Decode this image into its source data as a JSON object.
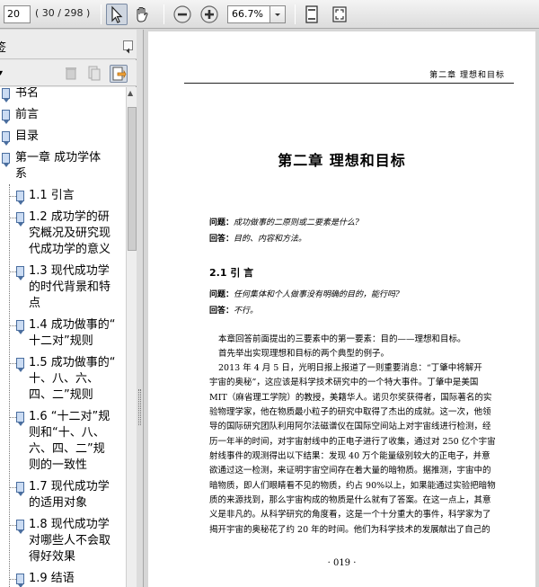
{
  "toolbar": {
    "page_current": "20",
    "page_count": "( 30 / 298 )",
    "zoom_value": "66.7%",
    "icons": [
      "select-tool-icon",
      "hand-tool-icon",
      "zoom-out-icon",
      "zoom-in-icon",
      "fit-page-icon",
      "full-screen-icon"
    ]
  },
  "sidebar": {
    "title": "签",
    "bookmarks": [
      {
        "lines": [
          "书名"
        ]
      },
      {
        "lines": [
          "前言"
        ]
      },
      {
        "lines": [
          "目录"
        ]
      },
      {
        "lines": [
          "第一章  成功学体",
          "系"
        ]
      },
      {
        "lines": [
          "1.1  引言"
        ]
      },
      {
        "lines": [
          "1.2  成功学的研",
          "究概况及研究现",
          "代成功学的意义"
        ]
      },
      {
        "lines": [
          "1.3  现代成功学",
          "的时代背景和特",
          "点"
        ]
      },
      {
        "lines": [
          "1.4  成功做事的“",
          "十二对”规则"
        ]
      },
      {
        "lines": [
          "1.5  成功做事的“",
          "十、八、六、",
          "四、二”规则"
        ]
      },
      {
        "lines": [
          "1.6  “十二对”规",
          "则和“十、八、",
          "六、四、二”规",
          "则的一致性"
        ]
      },
      {
        "lines": [
          "1.7  现代成功学",
          "的适用对象"
        ]
      },
      {
        "lines": [
          "1.8  现代成功学",
          "对哪些人不会取",
          "得好效果"
        ]
      },
      {
        "lines": [
          "1.9  结语"
        ]
      }
    ]
  },
  "document": {
    "running_head": "第二章  理想和目标",
    "chapter_title": "第二章    理想和目标",
    "qa1": [
      {
        "label": "问题：",
        "text": "成功做事的二原则或二要素是什么?"
      },
      {
        "label": "回答：",
        "text": "目的、内容和方法。"
      }
    ],
    "section_title": "2.1  引    言",
    "qa2": [
      {
        "label": "问题：",
        "text": "任何集体和个人做事没有明确的目的，能行吗?"
      },
      {
        "label": "回答：",
        "text": "不行。"
      }
    ],
    "paragraphs": [
      "本章回答前面提出的三要素中的第一要素：目的——理想和目标。",
      "首先举出实现理想和目标的两个典型的例子。",
      "2013 年 4 月 5 日，光明日报上报道了一则重要消息：“丁肇中将解开",
      "宇宙的奥秘”，这应该是科学技术研究中的一个特大事件。丁肇中是美国",
      "MIT（麻省理工学院）的教授，美籍华人。诺贝尔奖获得者，国际著名的实",
      "验物理学家，他在物质最小粒子的研究中取得了杰出的成就。这一次，他领",
      "导的国际研究团队利用阿尔法磁谱仪在国际空间站上对宇宙线进行检测，经",
      "历一年半的时间，对宇宙射线中的正电子进行了收集，通过对 250 亿个宇宙",
      "射线事件的观测得出以下结果：发现 40 万个能量级别较大的正电子，并意",
      "欲通过这一检测，来证明宇宙空间存在着大量的暗物质。据推测，宇宙中的",
      "暗物质，即人们眼睛看不见的物质，约占 90%以上，如果能通过实验把暗物",
      "质的来源找到，那么宇宙构成的物质是什么就有了答案。在这一点上，其意",
      "义是非凡的。从科学研究的角度看，这是一个十分重大的事件，科学家为了",
      "揭开宇宙的奥秘花了约 20 年的时间。他们为科学技术的发展献出了自己的"
    ],
    "page_number": "· 019 ·"
  }
}
